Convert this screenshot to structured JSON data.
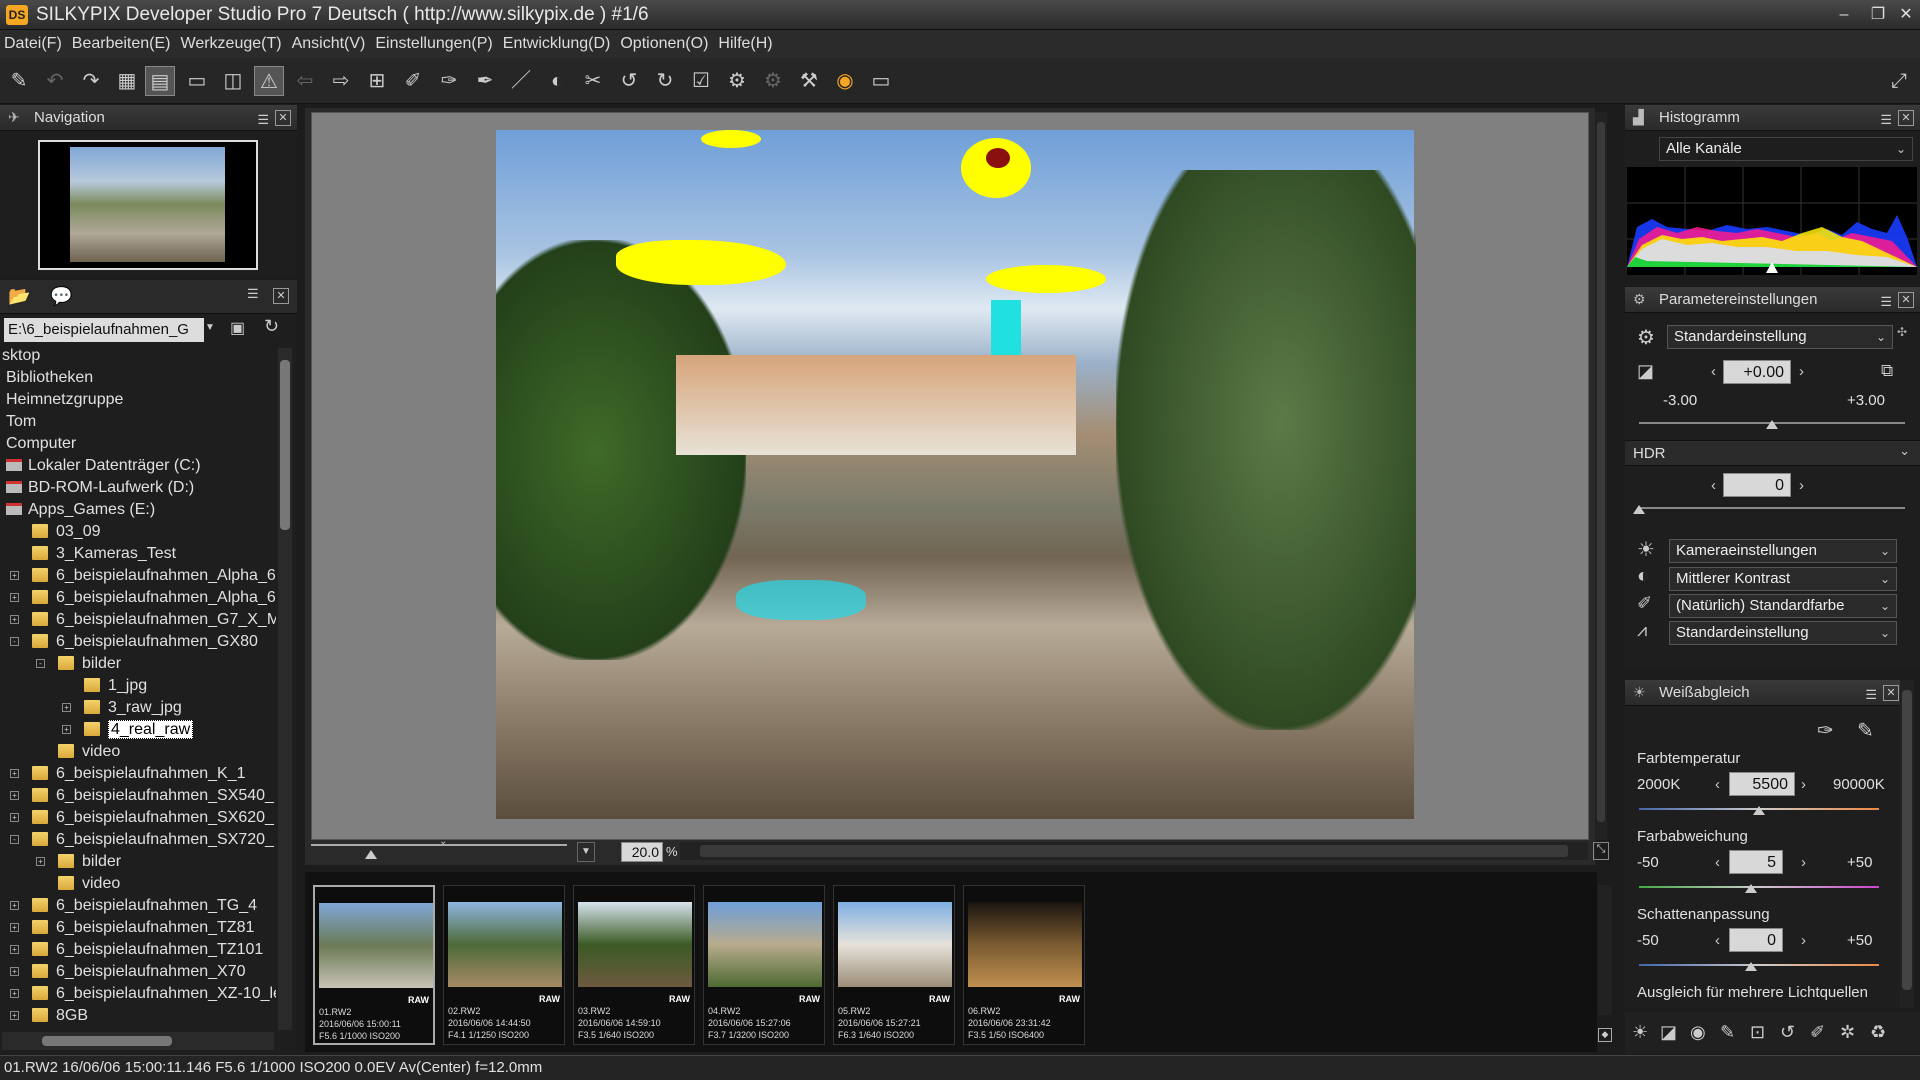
{
  "window": {
    "title": "SILKYPIX Developer Studio Pro 7 Deutsch ( http://www.silkypix.de )   #1/6",
    "logo": "DS"
  },
  "menu": [
    "Datei(F)",
    "Bearbeiten(E)",
    "Werkzeuge(T)",
    "Ansicht(V)",
    "Einstellungen(P)",
    "Entwicklung(D)",
    "Optionen(O)",
    "Hilfe(H)"
  ],
  "navigation": {
    "title": "Navigation"
  },
  "browser": {
    "path": "E:\\6_beispielaufnahmen_G",
    "tree": [
      {
        "label": "sktop",
        "indent": 0,
        "type": "none"
      },
      {
        "label": "Bibliotheken",
        "indent": 0,
        "type": "none"
      },
      {
        "label": "Heimnetzgruppe",
        "indent": 0,
        "type": "none"
      },
      {
        "label": "Tom",
        "indent": 0,
        "type": "none"
      },
      {
        "label": "Computer",
        "indent": 0,
        "type": "none"
      },
      {
        "label": "Lokaler Datenträger (C:)",
        "indent": 0,
        "type": "drive"
      },
      {
        "label": "BD-ROM-Laufwerk (D:)",
        "indent": 0,
        "type": "drive"
      },
      {
        "label": "Apps_Games (E:)",
        "indent": 0,
        "type": "drive"
      },
      {
        "label": "03_09",
        "indent": 1,
        "type": "folder"
      },
      {
        "label": "3_Kameras_Test",
        "indent": 1,
        "type": "folder"
      },
      {
        "label": "6_beispielaufnahmen_Alpha_6",
        "indent": 1,
        "type": "folder",
        "exp": "+"
      },
      {
        "label": "6_beispielaufnahmen_Alpha_6",
        "indent": 1,
        "type": "folder",
        "exp": "+"
      },
      {
        "label": "6_beispielaufnahmen_G7_X_M",
        "indent": 1,
        "type": "folder",
        "exp": "+"
      },
      {
        "label": "6_beispielaufnahmen_GX80",
        "indent": 1,
        "type": "folder",
        "exp": "-"
      },
      {
        "label": "bilder",
        "indent": 2,
        "type": "folder",
        "exp": "-"
      },
      {
        "label": "1_jpg",
        "indent": 3,
        "type": "folder"
      },
      {
        "label": "3_raw_jpg",
        "indent": 3,
        "type": "folder",
        "exp": "+"
      },
      {
        "label": "4_real_raw",
        "indent": 3,
        "type": "folder",
        "exp": "+",
        "selected": true
      },
      {
        "label": "video",
        "indent": 2,
        "type": "folder"
      },
      {
        "label": "6_beispielaufnahmen_K_1",
        "indent": 1,
        "type": "folder",
        "exp": "+"
      },
      {
        "label": "6_beispielaufnahmen_SX540_",
        "indent": 1,
        "type": "folder",
        "exp": "+"
      },
      {
        "label": "6_beispielaufnahmen_SX620_",
        "indent": 1,
        "type": "folder",
        "exp": "+"
      },
      {
        "label": "6_beispielaufnahmen_SX720_",
        "indent": 1,
        "type": "folder",
        "exp": "-"
      },
      {
        "label": "bilder",
        "indent": 2,
        "type": "folder",
        "exp": "+"
      },
      {
        "label": "video",
        "indent": 2,
        "type": "folder"
      },
      {
        "label": "6_beispielaufnahmen_TG_4",
        "indent": 1,
        "type": "folder",
        "exp": "+"
      },
      {
        "label": "6_beispielaufnahmen_TZ81",
        "indent": 1,
        "type": "folder",
        "exp": "+"
      },
      {
        "label": "6_beispielaufnahmen_TZ101",
        "indent": 1,
        "type": "folder",
        "exp": "+"
      },
      {
        "label": "6_beispielaufnahmen_X70",
        "indent": 1,
        "type": "folder",
        "exp": "+"
      },
      {
        "label": "6_beispielaufnahmen_XZ-10_le",
        "indent": 1,
        "type": "folder",
        "exp": "+"
      },
      {
        "label": "8GB",
        "indent": 1,
        "type": "folder",
        "exp": "+"
      }
    ]
  },
  "viewer": {
    "zoom": "20.0",
    "zoom_unit": "%"
  },
  "filmstrip": [
    {
      "name": "01.RW2",
      "date": "2016/06/06 15:00:11",
      "exif": "F5.6 1/1000 ISO200",
      "badge": "RAW",
      "colors": [
        "#7fa7d6",
        "#6b7a55",
        "#c9c3b8"
      ]
    },
    {
      "name": "02.RW2",
      "date": "2016/06/06 14:44:50",
      "exif": "F4.1 1/1250 ISO200",
      "badge": "RAW",
      "colors": [
        "#8fb6e0",
        "#4d6a38",
        "#a58a65"
      ]
    },
    {
      "name": "03.RW2",
      "date": "2016/06/06 14:59:10",
      "exif": "F3.5 1/640 ISO200",
      "badge": "RAW",
      "colors": [
        "#d7e4ef",
        "#3b5a24",
        "#6d5a40"
      ]
    },
    {
      "name": "04.RW2",
      "date": "2016/06/06 15:27:06",
      "exif": "F3.7 1/3200 ISO200",
      "badge": "RAW",
      "colors": [
        "#6e9fd9",
        "#b8ab8d",
        "#4e6a32"
      ]
    },
    {
      "name": "05.RW2",
      "date": "2016/06/06 15:27:21",
      "exif": "F6.3 1/640 ISO200",
      "badge": "RAW",
      "colors": [
        "#7fb0e4",
        "#e6e2da",
        "#9c8d77"
      ]
    },
    {
      "name": "06.RW2",
      "date": "2016/06/06 23:31:42",
      "exif": "F3.5 1/50 ISO6400",
      "badge": "RAW",
      "colors": [
        "#1a1410",
        "#7a5a30",
        "#c09050"
      ]
    }
  ],
  "histogram": {
    "title": "Histogramm",
    "channel": "Alle Kanäle"
  },
  "params": {
    "title": "Parametereinstellungen",
    "preset": "Standardeinstellung",
    "exposure": {
      "value": "+0.00",
      "min": "-3.00",
      "max": "+3.00",
      "level_pct": 50
    },
    "hdr": {
      "label": "HDR",
      "value": "0",
      "level_pct": 0
    },
    "camera": "Kameraeinstellungen",
    "contrast": "Mittlerer Kontrast",
    "color": "(Natürlich) Standardfarbe",
    "sharpness": "Standardeinstellung"
  },
  "wb": {
    "title": "Weißabgleich",
    "temp": {
      "label": "Farbtemperatur",
      "min": "2000K",
      "max": "90000K",
      "value": "5500"
    },
    "tint": {
      "label": "Farbabweichung",
      "min": "-50",
      "max": "+50",
      "value": "5"
    },
    "shadow": {
      "label": "Schattenanpassung",
      "min": "-50",
      "max": "+50",
      "value": "0"
    },
    "multi": "Ausgleich für mehrere Lichtquellen"
  },
  "status": "01.RW2 16/06/06 15:00:11.146 F5.6 1/1000 ISO200  0.0EV Av(Center) f=12.0mm",
  "colors": {
    "accent": "#f5a623",
    "bg": "#1c1c1c",
    "viewerbg": "#808080"
  }
}
